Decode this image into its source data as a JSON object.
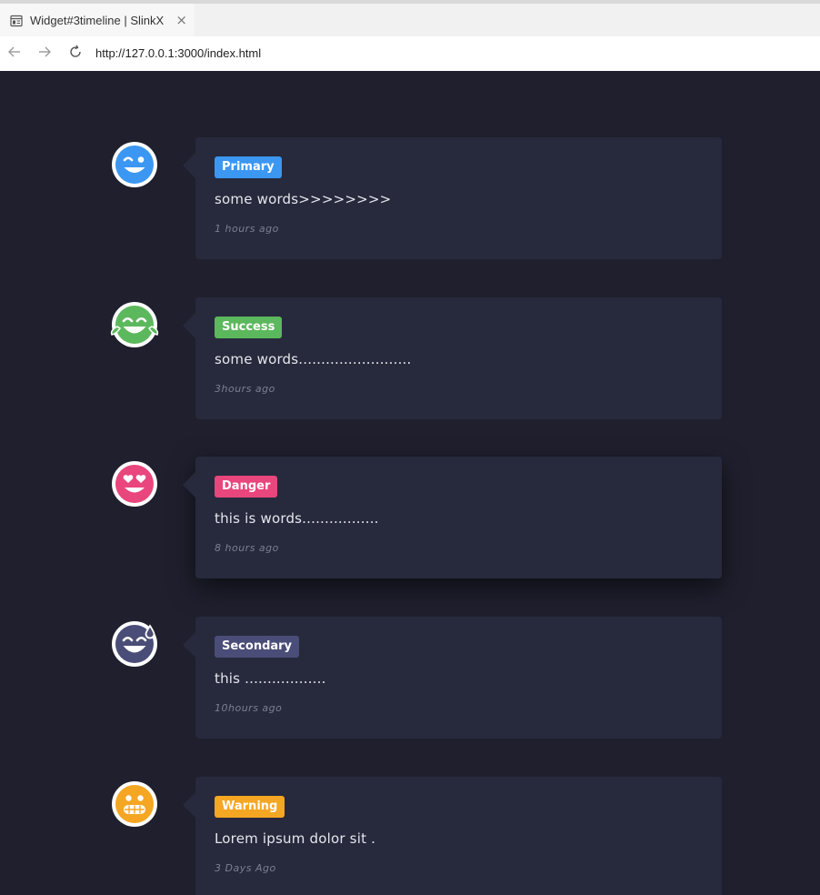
{
  "browser": {
    "tab_title": "Widget#3timeline | SlinkX",
    "tab_close": "×",
    "url": "http://127.0.0.1:3000/index.html"
  },
  "timeline": {
    "items": [
      {
        "badge": "Primary",
        "badge_color": "#3b97f2",
        "text": "some words>>>>>>>>",
        "time": "1 hours ago",
        "avatar": "winking-face-icon",
        "avatar_color": "#3b97f2"
      },
      {
        "badge": "Success",
        "badge_color": "#5cb85c",
        "text": "some words.........................",
        "time": "3hours ago",
        "avatar": "tears-of-joy-face-icon",
        "avatar_color": "#5cb85c"
      },
      {
        "badge": "Danger",
        "badge_color": "#e8467c",
        "text": "this is words.................",
        "time": "8 hours ago",
        "avatar": "heart-eyes-face-icon",
        "avatar_color": "#e8467c"
      },
      {
        "badge": "Secondary",
        "badge_color": "#4a4d77",
        "text": "this ..................",
        "time": "10hours ago",
        "avatar": "grinning-sweat-face-icon",
        "avatar_color": "#4a4d77"
      },
      {
        "badge": "Warning",
        "badge_color": "#f5a623",
        "text": "Lorem ipsum dolor sit .",
        "time": "3 Days Ago",
        "avatar": "grimacing-face-icon",
        "avatar_color": "#f5a623"
      }
    ]
  }
}
